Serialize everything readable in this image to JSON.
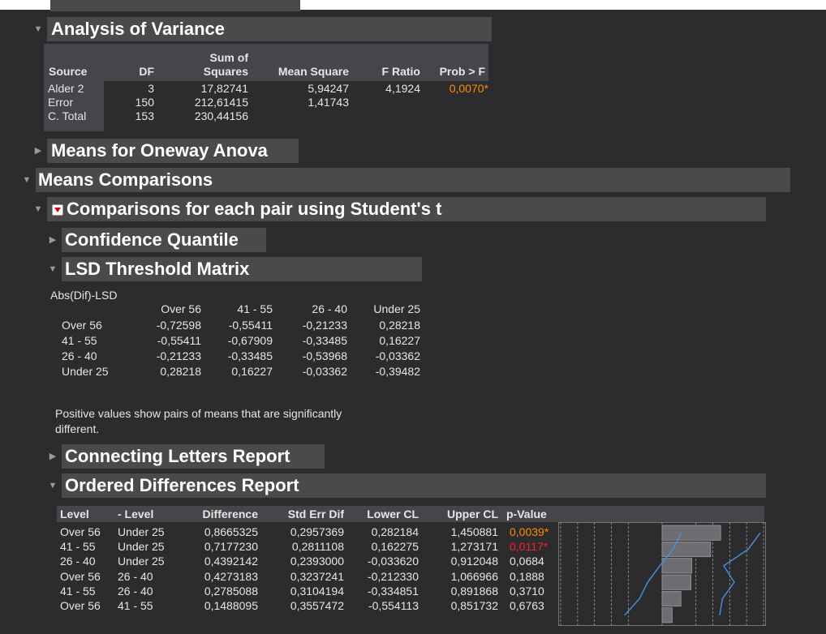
{
  "anova": {
    "title": "Analysis of Variance",
    "headers": {
      "source": "Source",
      "df": "DF",
      "ss_top": "Sum of",
      "ss_bottom": "Squares",
      "ms": "Mean Square",
      "f": "F Ratio",
      "p": "Prob > F"
    },
    "rows": [
      {
        "source": "Alder 2",
        "df": "3",
        "ss": "17,82741",
        "ms": "5,94247",
        "f": "4,1924",
        "p": "0,0070*"
      },
      {
        "source": "Error",
        "df": "150",
        "ss": "212,61415",
        "ms": "1,41743",
        "f": "",
        "p": ""
      },
      {
        "source": "C. Total",
        "df": "153",
        "ss": "230,44156",
        "ms": "",
        "f": "",
        "p": ""
      }
    ]
  },
  "means_oneway_title": "Means for Oneway Anova",
  "means_comparisons_title": "Means Comparisons",
  "comparisons_title": "Comparisons for each pair using Student's t",
  "confidence_quantile_title": "Confidence Quantile",
  "lsd": {
    "title": "LSD Threshold Matrix",
    "caption": "Abs(Dif)-LSD",
    "columns": [
      "Over 56",
      "41 - 55",
      "26 - 40",
      "Under 25"
    ],
    "rows": [
      {
        "label": "Over 56",
        "values": [
          "-0,72598",
          "-0,55411",
          "-0,21233",
          "0,28218"
        ]
      },
      {
        "label": "41 - 55",
        "values": [
          "-0,55411",
          "-0,67909",
          "-0,33485",
          "0,16227"
        ]
      },
      {
        "label": "26 - 40",
        "values": [
          "-0,21233",
          "-0,33485",
          "-0,53968",
          "-0,03362"
        ]
      },
      {
        "label": "Under 25",
        "values": [
          "0,28218",
          "0,16227",
          "-0,03362",
          "-0,39482"
        ]
      }
    ],
    "note_line1": "Positive values show pairs of means that are significantly",
    "note_line2": "different."
  },
  "connecting_letters_title": "Connecting Letters Report",
  "ordered": {
    "title": "Ordered Differences Report",
    "headers": [
      "Level",
      "- Level",
      "Difference",
      "Std Err Dif",
      "Lower CL",
      "Upper CL",
      "p-Value"
    ],
    "rows": [
      {
        "level": "Over 56",
        "minus": "Under 25",
        "diff": "0,8665325",
        "se": "0,2957369",
        "lcl": "0,282184",
        "ucl": "1,450881",
        "p": "0,0039*",
        "p_color": "#ff8c00"
      },
      {
        "level": "41 - 55",
        "minus": "Under 25",
        "diff": "0,7177230",
        "se": "0,2811108",
        "lcl": "0,162275",
        "ucl": "1,273171",
        "p": "0,0117*",
        "p_color": "#ff1a2e"
      },
      {
        "level": "26 - 40",
        "minus": "Under 25",
        "diff": "0,4392142",
        "se": "0,2393000",
        "lcl": "-0,033620",
        "ucl": "0,912048",
        "p": "0,0684",
        "p_color": ""
      },
      {
        "level": "Over 56",
        "minus": "26 - 40",
        "diff": "0,4273183",
        "se": "0,3237241",
        "lcl": "-0,212330",
        "ucl": "1,066966",
        "p": "0,1888",
        "p_color": ""
      },
      {
        "level": "41 - 55",
        "minus": "26 - 40",
        "diff": "0,2785088",
        "se": "0,3104194",
        "lcl": "-0,334851",
        "ucl": "0,891868",
        "p": "0,3710",
        "p_color": ""
      },
      {
        "level": "Over 56",
        "minus": "41 - 55",
        "diff": "0,1488095",
        "se": "0,3557472",
        "lcl": "-0,554113",
        "ucl": "0,851732",
        "p": "0,6763",
        "p_color": ""
      }
    ]
  },
  "chart_data": {
    "type": "bar",
    "categories": [
      "Over 56 - Under 25",
      "41 - 55 - Under 25",
      "26 - 40 - Under 25",
      "Over 56 - 26 - 40",
      "41 - 55 - 26 - 40",
      "Over 56 - 41 - 55"
    ],
    "values": [
      0.8665325,
      0.717723,
      0.4392142,
      0.4273183,
      0.2785088,
      0.1488095
    ],
    "p_values": [
      0.0039,
      0.0117,
      0.0684,
      0.1888,
      0.371,
      0.6763
    ],
    "orientation": "horizontal",
    "xlim": [
      -1.5,
      1.5
    ],
    "grid": true,
    "colors": {
      "bar": "#6e6e72",
      "line": "#4a90e2"
    }
  },
  "colors": {
    "background": "#2c2c2e",
    "panel": "#4a4a4c",
    "significant_orange": "#ff8c00",
    "significant_red": "#ff1a2e"
  }
}
